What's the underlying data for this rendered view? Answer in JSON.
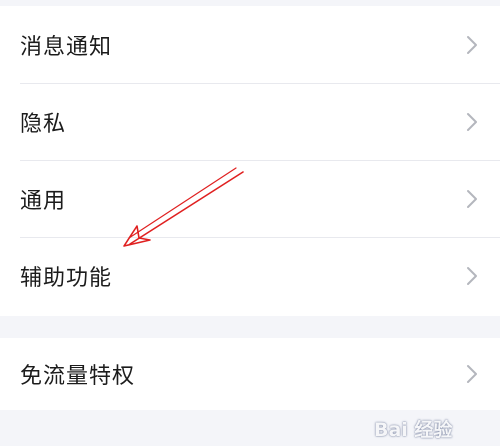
{
  "settings": {
    "group1": [
      {
        "label": "消息通知"
      },
      {
        "label": "隐私"
      },
      {
        "label": "通用"
      },
      {
        "label": "辅助功能"
      }
    ],
    "group2": [
      {
        "label": "免流量特权"
      }
    ]
  },
  "icons": {
    "row_chevron": "chevron-right-icon"
  },
  "watermark": {
    "text": "Bai 经验"
  },
  "colors": {
    "background": "#f4f5f9",
    "card": "#ffffff",
    "text": "#1c1c1c",
    "chevron": "#b4b6bd",
    "annotation_arrow": "#e02020"
  }
}
